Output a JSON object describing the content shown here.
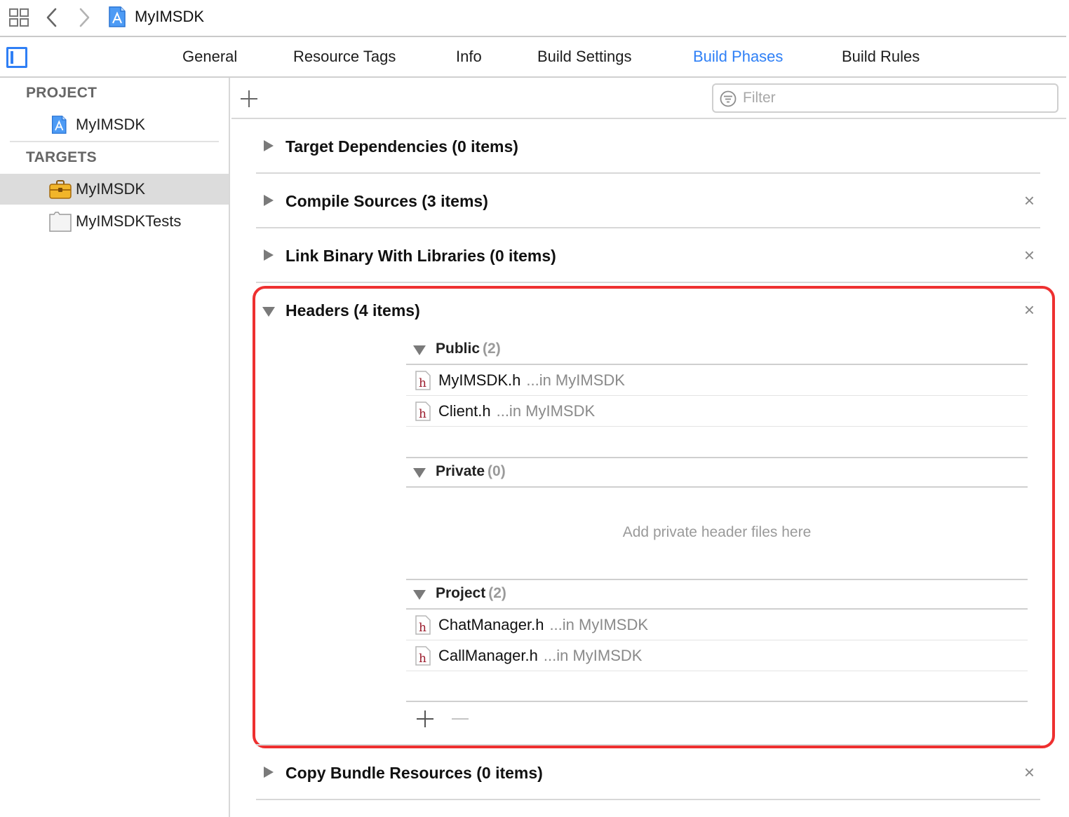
{
  "toolbar": {
    "breadcrumb_label": "MyIMSDK",
    "icons": [
      "grid-icon",
      "chevron-left-icon",
      "chevron-right-icon",
      "xcode-project-icon"
    ]
  },
  "tabs": {
    "general": "General",
    "resource_tags": "Resource Tags",
    "info": "Info",
    "build_settings": "Build Settings",
    "build_phases": "Build Phases",
    "build_rules": "Build Rules",
    "active": "Build Phases"
  },
  "sidebar": {
    "project_header": "PROJECT",
    "project_item": "MyIMSDK",
    "targets_header": "TARGETS",
    "targets": [
      {
        "label": "MyIMSDK",
        "icon": "framework-toolbox-icon",
        "selected": true
      },
      {
        "label": "MyIMSDKTests",
        "icon": "test-bundle-icon",
        "selected": false
      }
    ]
  },
  "main": {
    "filter_placeholder": "Filter",
    "phases": [
      {
        "title": "Target Dependencies (0 items)",
        "expanded": false,
        "removable": false
      },
      {
        "title": "Compile Sources (3 items)",
        "expanded": false,
        "removable": true
      },
      {
        "title": "Link Binary With Libraries (0 items)",
        "expanded": false,
        "removable": true
      },
      {
        "title": "Headers (4 items)",
        "expanded": true,
        "removable": true
      },
      {
        "title": "Copy Bundle Resources (0 items)",
        "expanded": false,
        "removable": true
      }
    ],
    "close_glyph": "×",
    "headers": {
      "public": {
        "name": "Public",
        "count": "(2)",
        "files": [
          {
            "name": "MyIMSDK.h",
            "location": "...in MyIMSDK"
          },
          {
            "name": "Client.h",
            "location": "...in MyIMSDK"
          }
        ]
      },
      "private": {
        "name": "Private",
        "count": "(0)",
        "empty_note": "Add private header files here"
      },
      "project": {
        "name": "Project",
        "count": "(2)",
        "files": [
          {
            "name": "ChatManager.h",
            "location": "...in MyIMSDK"
          },
          {
            "name": "CallManager.h",
            "location": "...in MyIMSDK"
          }
        ]
      }
    }
  },
  "colors": {
    "accent": "#2f80f6",
    "highlight_border": "#ee3030",
    "selected_row": "#dcdcdc",
    "header_file_letter": "#9b1c2c"
  }
}
